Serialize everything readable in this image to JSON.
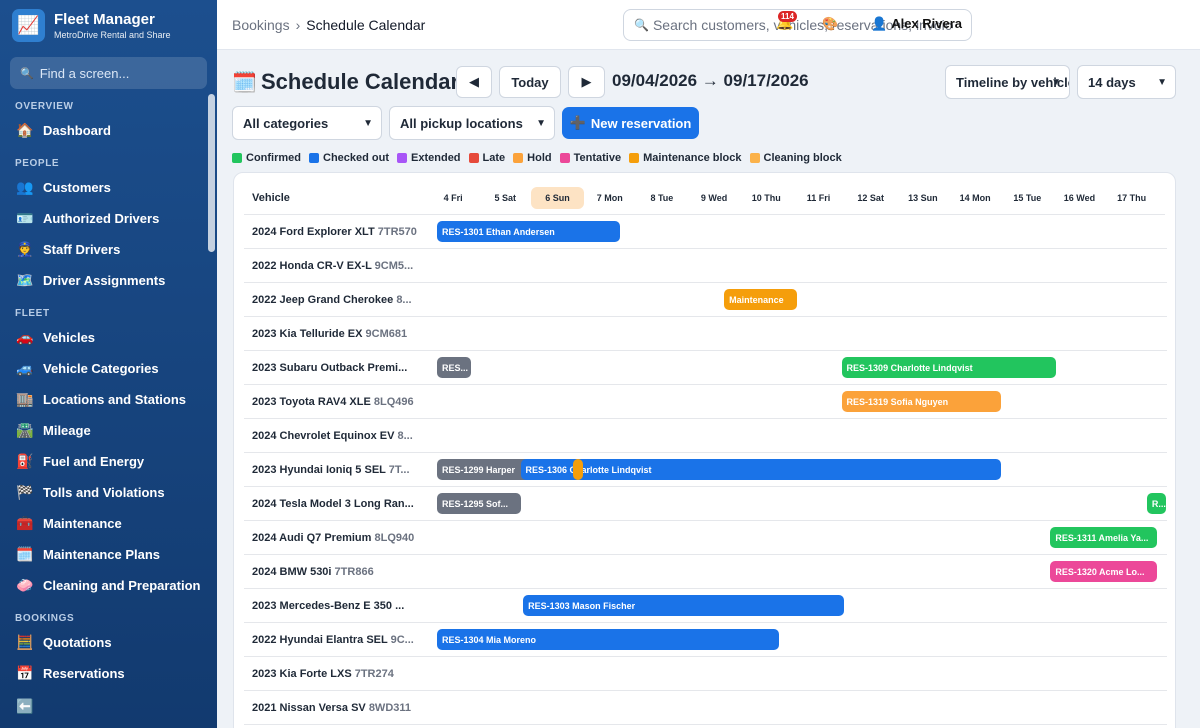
{
  "app": {
    "name": "Fleet Manager",
    "subtitle": "MetroDrive Rental and Share"
  },
  "sidebar": {
    "find_placeholder": "Find a screen...",
    "sections": [
      {
        "title": "OVERVIEW",
        "items": [
          {
            "label": "Dashboard",
            "icon": "house-icon",
            "glyph": "🏠"
          }
        ]
      },
      {
        "title": "PEOPLE",
        "items": [
          {
            "label": "Customers",
            "icon": "people-icon",
            "glyph": "👥"
          },
          {
            "label": "Authorized Drivers",
            "icon": "id-card-icon",
            "glyph": "🪪"
          },
          {
            "label": "Staff Drivers",
            "icon": "staff-driver-icon",
            "glyph": "👮"
          },
          {
            "label": "Driver Assignments",
            "icon": "map-icon",
            "glyph": "🗺️"
          }
        ]
      },
      {
        "title": "FLEET",
        "items": [
          {
            "label": "Vehicles",
            "icon": "car-icon",
            "glyph": "🚗"
          },
          {
            "label": "Vehicle Categories",
            "icon": "suv-icon",
            "glyph": "🚙"
          },
          {
            "label": "Locations and Stations",
            "icon": "building-icon",
            "glyph": "🏬"
          },
          {
            "label": "Mileage",
            "icon": "road-icon",
            "glyph": "🛣️"
          },
          {
            "label": "Fuel and Energy",
            "icon": "fuel-pump-icon",
            "glyph": "⛽"
          },
          {
            "label": "Tolls and Violations",
            "icon": "checkered-flag-icon",
            "glyph": "🏁"
          },
          {
            "label": "Maintenance",
            "icon": "toolbox-icon",
            "glyph": "🧰"
          },
          {
            "label": "Maintenance Plans",
            "icon": "calendar-icon",
            "glyph": "🗓️"
          },
          {
            "label": "Cleaning and Preparation",
            "icon": "soap-icon",
            "glyph": "🧼"
          }
        ]
      },
      {
        "title": "BOOKINGS",
        "items": [
          {
            "label": "Quotations",
            "icon": "abacus-icon",
            "glyph": "🧮"
          },
          {
            "label": "Reservations",
            "icon": "date-icon",
            "glyph": "📅"
          }
        ]
      }
    ],
    "collapse_glyph": "⬅️"
  },
  "topbar": {
    "breadcrumb_parent": "Bookings",
    "breadcrumb_sep": "›",
    "breadcrumb_current": "Schedule Calendar",
    "search_placeholder": "Search customers, vehicles, reservations, invoices...",
    "notifications_count": "114",
    "user_name": "Alex Rivera"
  },
  "page": {
    "title": "Schedule Calendar",
    "prev_glyph": "◀",
    "today_label": "Today",
    "next_glyph": "▶",
    "date_range": "09/04/2026 → 09/17/2026",
    "view_select": "Timeline by vehicle",
    "span_select": "14 days",
    "category_filter": "All categories",
    "location_filter": "All pickup locations",
    "new_reservation_label": "New reservation",
    "new_reservation_glyph": "➕"
  },
  "legend": [
    {
      "label": "Confirmed",
      "color": "#22c55e"
    },
    {
      "label": "Checked out",
      "color": "#1a73e8"
    },
    {
      "label": "Extended",
      "color": "#a855f7"
    },
    {
      "label": "Late",
      "color": "#e64a3b"
    },
    {
      "label": "Hold",
      "color": "#fba23a"
    },
    {
      "label": "Tentative",
      "color": "#ec4899"
    },
    {
      "label": "Maintenance block",
      "color": "#f59e0b"
    },
    {
      "label": "Cleaning block",
      "color": "#fbb24a"
    }
  ],
  "calendar": {
    "vehicle_header": "Vehicle",
    "today_index": 2,
    "days": [
      "4 Fri",
      "5 Sat",
      "6 Sun",
      "7 Mon",
      "8 Tue",
      "9 Wed",
      "10 Thu",
      "11 Fri",
      "12 Sat",
      "13 Sun",
      "14 Mon",
      "15 Tue",
      "16 Wed",
      "17 Thu"
    ],
    "rows": [
      {
        "name": "2024 Ford Explorer XLT",
        "plate": "7TR570"
      },
      {
        "name": "2022 Honda CR-V EX-L",
        "plate": "9CM5..."
      },
      {
        "name": "2022 Jeep Grand Cherokee",
        "plate": "8..."
      },
      {
        "name": "2023 Kia Telluride EX",
        "plate": "9CM681"
      },
      {
        "name": "2023 Subaru Outback Premi...",
        "plate": ""
      },
      {
        "name": "2023 Toyota RAV4 XLE",
        "plate": "8LQ496"
      },
      {
        "name": "2024 Chevrolet Equinox EV",
        "plate": "8..."
      },
      {
        "name": "2023 Hyundai Ioniq 5 SEL",
        "plate": "7T..."
      },
      {
        "name": "2024 Tesla Model 3 Long Ran...",
        "plate": ""
      },
      {
        "name": "2024 Audi Q7 Premium",
        "plate": "8LQ940"
      },
      {
        "name": "2024 BMW 530i",
        "plate": "7TR866"
      },
      {
        "name": "2023 Mercedes-Benz E 350 ...",
        "plate": ""
      },
      {
        "name": "2022 Hyundai Elantra SEL",
        "plate": "9C..."
      },
      {
        "name": "2023 Kia Forte LXS",
        "plate": "7TR274"
      },
      {
        "name": "2021 Nissan Versa SV",
        "plate": "8WD311"
      }
    ],
    "bookings": [
      {
        "row": 0,
        "start": 0,
        "end": 3.5,
        "label": "RES-1301 Ethan Andersen",
        "color": "#1a73e8"
      },
      {
        "row": 2,
        "start": 5.5,
        "end": 6.9,
        "label": "Maintenance",
        "color": "#f59e0b"
      },
      {
        "row": 4,
        "start": 0,
        "end": 0.65,
        "label": "RES...",
        "color": "#6b7280"
      },
      {
        "row": 4,
        "start": 7.75,
        "end": 11.85,
        "label": "RES-1309 Charlotte Lindqvist",
        "color": "#22c55e"
      },
      {
        "row": 5,
        "start": 7.75,
        "end": 10.8,
        "label": "RES-1319 Sofia Nguyen",
        "color": "#fba23a"
      },
      {
        "row": 7,
        "start": 0,
        "end": 5.6,
        "label": "RES-1299 Harper",
        "color": "#6b7280"
      },
      {
        "row": 7,
        "start": 1.6,
        "end": 10.8,
        "label": "RES-1306 Charlotte Lindqvist",
        "color": "#1a73e8"
      },
      {
        "row": 7,
        "start": 2.6,
        "end": 2.8,
        "label": "",
        "color": "#f59e0b"
      },
      {
        "row": 8,
        "start": 0,
        "end": 1.6,
        "label": "RES-1295 Sof...",
        "color": "#6b7280"
      },
      {
        "row": 8,
        "start": 13.6,
        "end": 14.1,
        "label": "R...",
        "color": "#22c55e"
      },
      {
        "row": 9,
        "start": 11.75,
        "end": 13.8,
        "label": "RES-1311 Amelia Ya...",
        "color": "#22c55e"
      },
      {
        "row": 10,
        "start": 11.75,
        "end": 13.8,
        "label": "RES-1320 Acme Lo...",
        "color": "#ec4899"
      },
      {
        "row": 11,
        "start": 1.65,
        "end": 7.8,
        "label": "RES-1303 Mason Fischer",
        "color": "#1a73e8"
      },
      {
        "row": 12,
        "start": 0,
        "end": 6.55,
        "label": "RES-1304 Mia Moreno",
        "color": "#1a73e8"
      }
    ]
  }
}
